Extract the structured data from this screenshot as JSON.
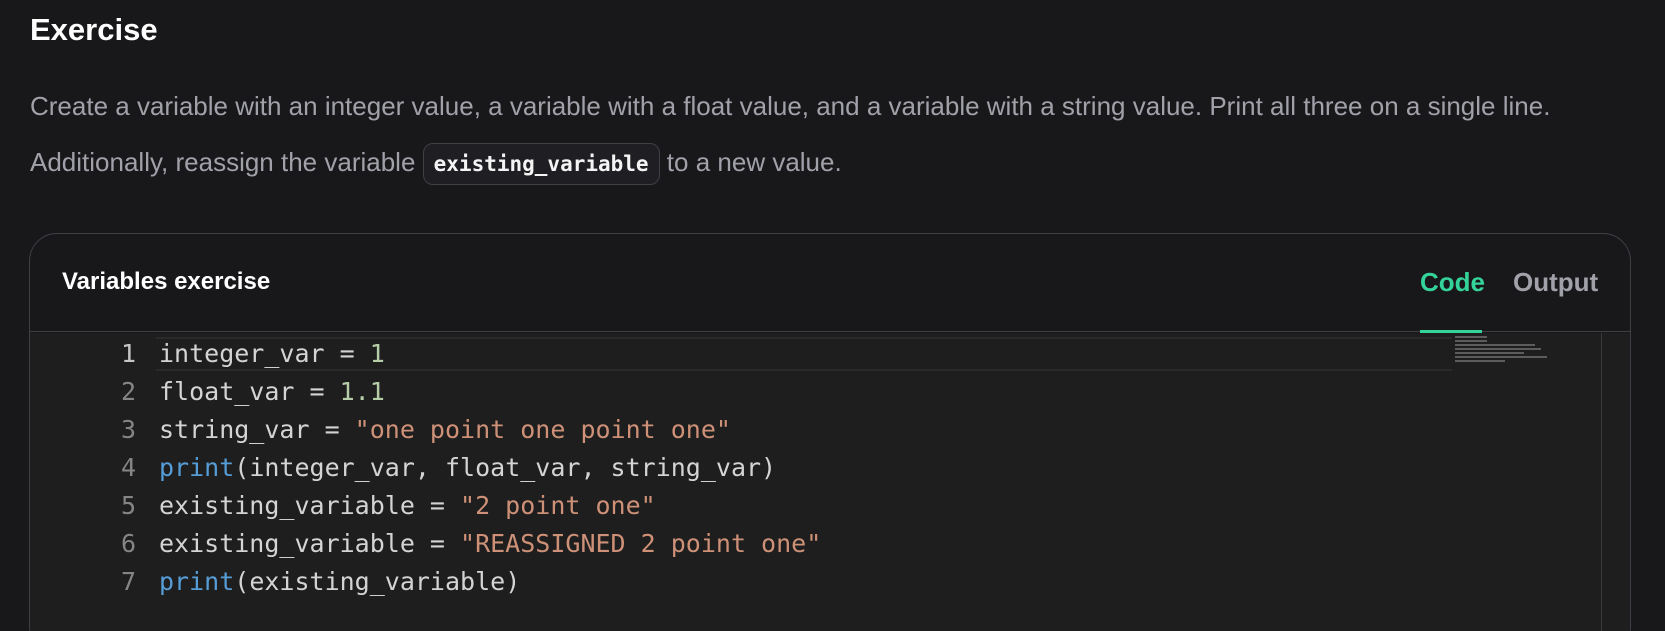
{
  "exercise": {
    "heading": "Exercise",
    "description_before": "Create a variable with an integer value, a variable with a float value, and a variable with a string value. Print all three on a single line. Additionally, reassign the variable ",
    "inline_code": "existing_variable",
    "description_after": " to a new value."
  },
  "card": {
    "title": "Variables exercise",
    "tabs": [
      {
        "label": "Code",
        "active": true
      },
      {
        "label": "Output",
        "active": false
      }
    ]
  },
  "editor": {
    "active_line": 1,
    "lines": [
      {
        "number": "1",
        "tokens": [
          {
            "t": "integer_var = ",
            "k": "plain"
          },
          {
            "t": "1",
            "k": "num"
          }
        ]
      },
      {
        "number": "2",
        "tokens": [
          {
            "t": "float_var = ",
            "k": "plain"
          },
          {
            "t": "1.1",
            "k": "num"
          }
        ]
      },
      {
        "number": "3",
        "tokens": [
          {
            "t": "string_var = ",
            "k": "plain"
          },
          {
            "t": "\"one point one point one\"",
            "k": "str"
          }
        ]
      },
      {
        "number": "4",
        "tokens": [
          {
            "t": "print",
            "k": "fn"
          },
          {
            "t": "(integer_var, float_var, string_var)",
            "k": "plain"
          }
        ]
      },
      {
        "number": "5",
        "tokens": [
          {
            "t": "existing_variable = ",
            "k": "plain"
          },
          {
            "t": "\"2 point one\"",
            "k": "str"
          }
        ]
      },
      {
        "number": "6",
        "tokens": [
          {
            "t": "existing_variable = ",
            "k": "plain"
          },
          {
            "t": "\"REASSIGNED 2 point one\"",
            "k": "str"
          }
        ]
      },
      {
        "number": "7",
        "tokens": [
          {
            "t": "print",
            "k": "fn"
          },
          {
            "t": "(existing_variable)",
            "k": "plain"
          }
        ]
      }
    ]
  },
  "colors": {
    "accent": "#34d399",
    "keyword_fn": "#569cd6",
    "number": "#b5cea8",
    "string": "#ce9178"
  }
}
